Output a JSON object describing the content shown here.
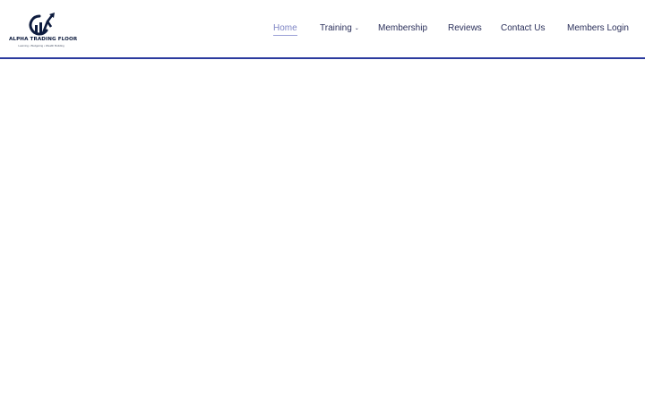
{
  "brand": {
    "name": "ALPHA TRADING FLOOR",
    "tagline": "Learning • Budgeting • Wealth Building",
    "logo_icon": "bar-chart-arrow-icon",
    "colors": {
      "primary": "#0d1b3e",
      "accent": "#2b3a9e"
    }
  },
  "nav": {
    "items": [
      {
        "label": "Home",
        "active": true
      },
      {
        "label": "Training",
        "has_dropdown": true,
        "dropdown_icon": "chevron-down-icon"
      },
      {
        "label": "Membership"
      },
      {
        "label": "Reviews"
      },
      {
        "label": "Contact Us"
      },
      {
        "label": "Members Login"
      }
    ]
  }
}
